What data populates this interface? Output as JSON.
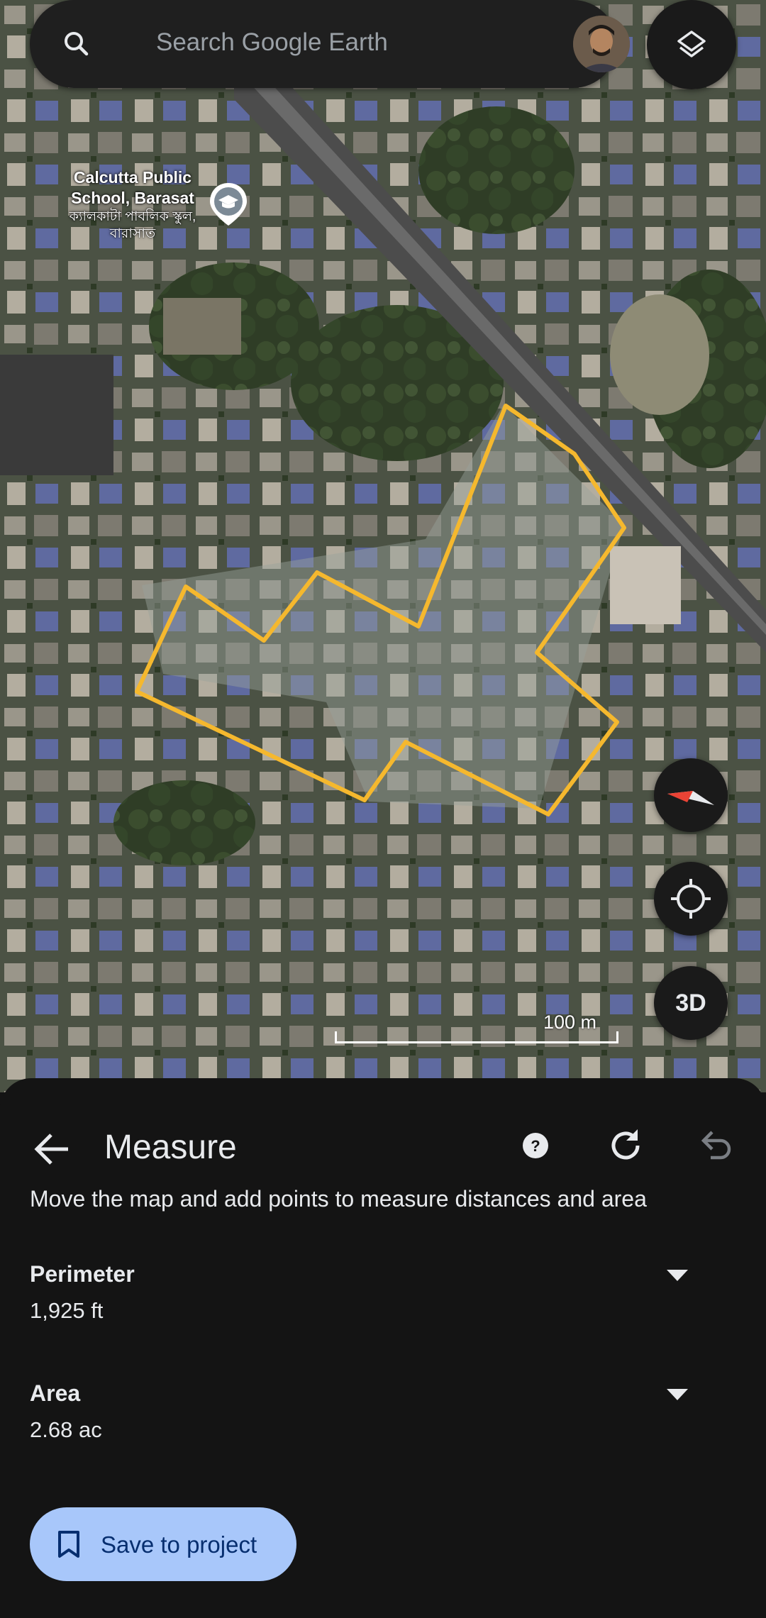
{
  "search": {
    "placeholder": "Search Google Earth"
  },
  "map": {
    "place_name": "Calcutta Public School, Barasat",
    "place_name_local": "ক্যালকাটা পাবলিক স্কুল, বারাসাত",
    "scale_label": "100 m",
    "outline_color": "#f5b82e"
  },
  "controls": {
    "layers_icon": "layers-icon",
    "compass_icon": "compass-icon",
    "locate_icon": "my-location-icon",
    "three_d_label": "3D"
  },
  "panel": {
    "title": "Measure",
    "instructions": "Move the map and add points to measure distances and area",
    "measurements": [
      {
        "label": "Perimeter",
        "value": "1,925 ft"
      },
      {
        "label": "Area",
        "value": "2.68 ac"
      }
    ],
    "save_label": "Save to project"
  },
  "colors": {
    "sheet_bg": "#141414",
    "save_button_bg": "#a8c7fa",
    "save_button_text": "#062e6f"
  }
}
